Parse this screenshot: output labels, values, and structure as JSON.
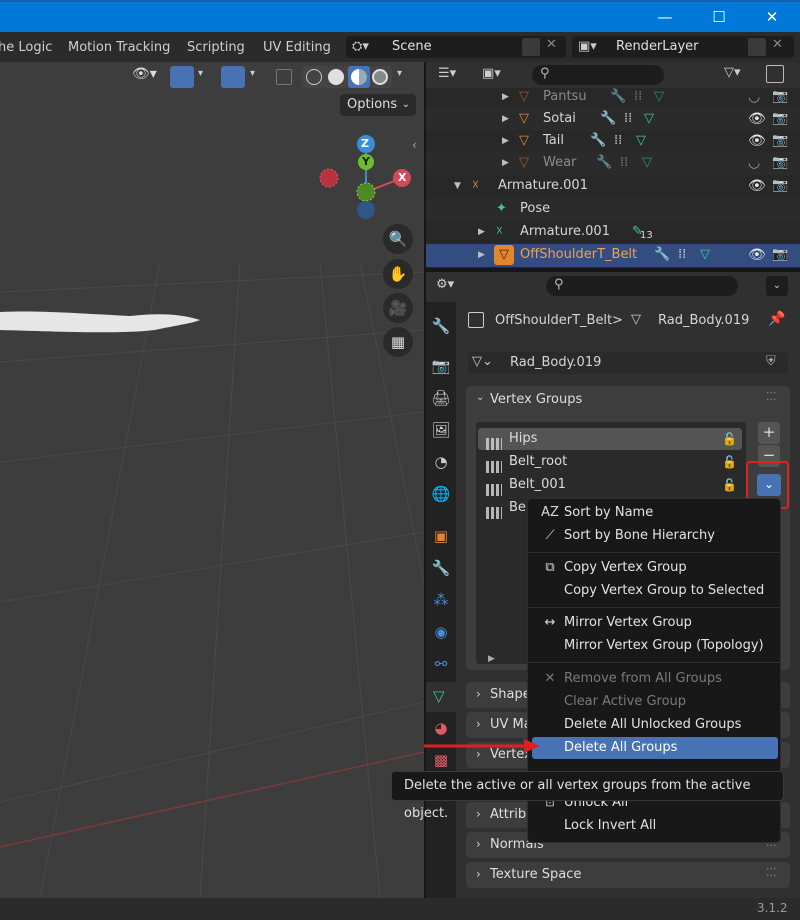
{
  "titlebar": {
    "minimize": "—",
    "maximize": "☐",
    "close": "✕"
  },
  "workspaces": [
    "he Logic",
    "Motion Tracking",
    "Scripting",
    "UV Editing"
  ],
  "scene": {
    "value": "Scene"
  },
  "render_layer": {
    "value": "RenderLayer"
  },
  "viewport": {
    "options_label": "Options",
    "gizmo": {
      "z": "Z",
      "y": "Y",
      "x": "X"
    }
  },
  "outliner": {
    "rows": [
      {
        "name": "Pantsu",
        "disabled": true
      },
      {
        "name": "Sotai",
        "disabled": false
      },
      {
        "name": "Tail",
        "disabled": false
      },
      {
        "name": "Wear",
        "disabled": true
      },
      {
        "name": "Armature.001",
        "disabled": false
      },
      {
        "name": "Pose",
        "disabled": false
      },
      {
        "name": "Armature.001",
        "disabled": false,
        "badge": "13"
      },
      {
        "name": "OffShoulderT_Belt",
        "selected": true
      }
    ]
  },
  "properties": {
    "breadcrumb_object": "OffShoulderT_Belt",
    "breadcrumb_sep": ">",
    "breadcrumb_mesh": "Rad_Body.019",
    "mesh_name": "Rad_Body.019",
    "panels": {
      "vertex_groups": "Vertex Groups",
      "shape": "Shape",
      "uv": "UV Ma",
      "vertex": "Vertex",
      "attrib": "Attribu",
      "normals": "Normals",
      "texture_space": "Texture Space"
    },
    "vertex_groups": [
      "Hips",
      "Belt_root",
      "Belt_001",
      "Be"
    ],
    "add_label": "+",
    "remove_label": "−"
  },
  "menu": {
    "items": [
      {
        "label": "Sort by Name",
        "icon": "AZ",
        "state": "normal"
      },
      {
        "label": "Sort by Bone Hierarchy",
        "icon": "bone-icon",
        "state": "normal"
      },
      {
        "label": "Copy Vertex Group",
        "icon": "copy-icon",
        "state": "normal"
      },
      {
        "label": "Copy Vertex Group to Selected",
        "icon": "",
        "state": "normal"
      },
      {
        "label": "Mirror Vertex Group",
        "icon": "arrows-icon",
        "state": "normal"
      },
      {
        "label": "Mirror Vertex Group (Topology)",
        "icon": "",
        "state": "normal"
      },
      {
        "label": "Remove from All Groups",
        "icon": "x-icon",
        "state": "disabled"
      },
      {
        "label": "Clear Active Group",
        "icon": "",
        "state": "disabled"
      },
      {
        "label": "Delete All Unlocked Groups",
        "icon": "",
        "state": "normal"
      },
      {
        "label": "Delete All Groups",
        "icon": "",
        "state": "active"
      },
      {
        "label": "Unlock All",
        "icon": "lock-icon",
        "state": "normal"
      },
      {
        "label": "Lock Invert All",
        "icon": "",
        "state": "normal"
      }
    ]
  },
  "tooltip": {
    "text": "Delete the active or all vertex groups from the active object."
  },
  "status": {
    "version": "3.1.2"
  },
  "colors": {
    "accent": "#4772b3",
    "highlight_red": "#e02020",
    "mesh_orange": "#e3872f",
    "data_green": "#3fc7a0"
  }
}
